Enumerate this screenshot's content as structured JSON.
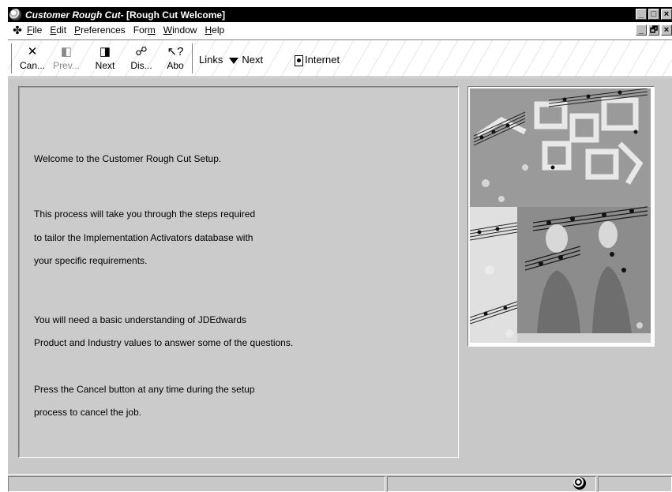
{
  "window": {
    "app_title": "Customer Rough Cut",
    "form_title": "- [Rough Cut Welcome]",
    "controls": {
      "minimize": "_",
      "maximize": "□",
      "close": "×",
      "restore": "🗗"
    }
  },
  "menu": {
    "items": [
      {
        "label": "File",
        "accel": "F"
      },
      {
        "label": "Edit",
        "accel": "E"
      },
      {
        "label": "Preferences",
        "accel": "P"
      },
      {
        "label": "Form",
        "accel": "m"
      },
      {
        "label": "Window",
        "accel": "W"
      },
      {
        "label": "Help",
        "accel": "H"
      }
    ]
  },
  "toolbar": {
    "cancel": "Can...",
    "prev": "Prev...",
    "next": "Next",
    "display": "Dis...",
    "about": "Abo",
    "links": "Links",
    "links_next": "Next",
    "internet": "Internet"
  },
  "panel": {
    "line1": "Welcome to the Customer Rough Cut Setup.",
    "line2": "This process will take you through the steps required",
    "line3": "to tailor the Implementation Activators database with",
    "line4": "your specific requirements.",
    "line5": "You will need a basic understanding of JDEdwards",
    "line6": "Product and Industry values to answer some of the questions.",
    "line7": "Press the Cancel button at any time during the setup",
    "line8": "process to cancel the job."
  },
  "colors": {
    "client_bg": "#c8c8c8",
    "titlebar": "#000000"
  }
}
